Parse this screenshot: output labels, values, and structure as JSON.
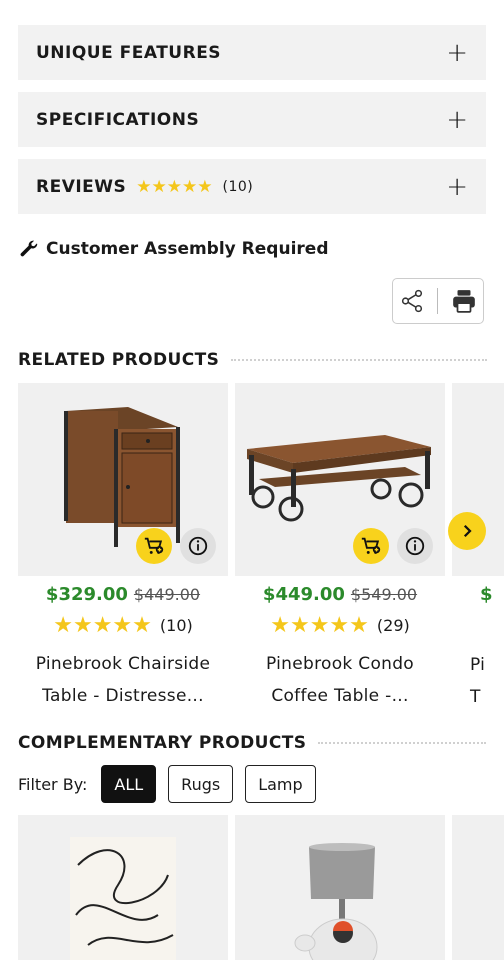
{
  "accordions": {
    "unique_features": "UNIQUE FEATURES",
    "specifications": "SPECIFICATIONS",
    "reviews": "REVIEWS",
    "reviews_stars": "★★★★★",
    "reviews_count": "(10)",
    "expand_symbol": "+"
  },
  "assembly": {
    "label": "Customer Assembly Required"
  },
  "related": {
    "title": "RELATED PRODUCTS",
    "products": [
      {
        "price": "$329.00",
        "old_price": "$449.00",
        "stars": "★★★★★",
        "rating_count": "(10)",
        "name_line1": "Pinebrook Chairside",
        "name_line2": "Table - Distresse..."
      },
      {
        "price": "$449.00",
        "old_price": "$549.00",
        "stars": "★★★★★",
        "rating_count": "(29)",
        "name_line1": "Pinebrook Condo",
        "name_line2": "Coffee Table -..."
      },
      {
        "price": "$",
        "name_line1": "Pi",
        "name_line2": "T"
      }
    ]
  },
  "complementary": {
    "title": "COMPLEMENTARY PRODUCTS",
    "filter_label": "Filter By:",
    "filters": [
      "ALL",
      "Rugs",
      "Lamp"
    ]
  },
  "colors": {
    "accent": "#f8d21c",
    "price_green": "#2b8a2b",
    "star": "#f4c61b"
  }
}
